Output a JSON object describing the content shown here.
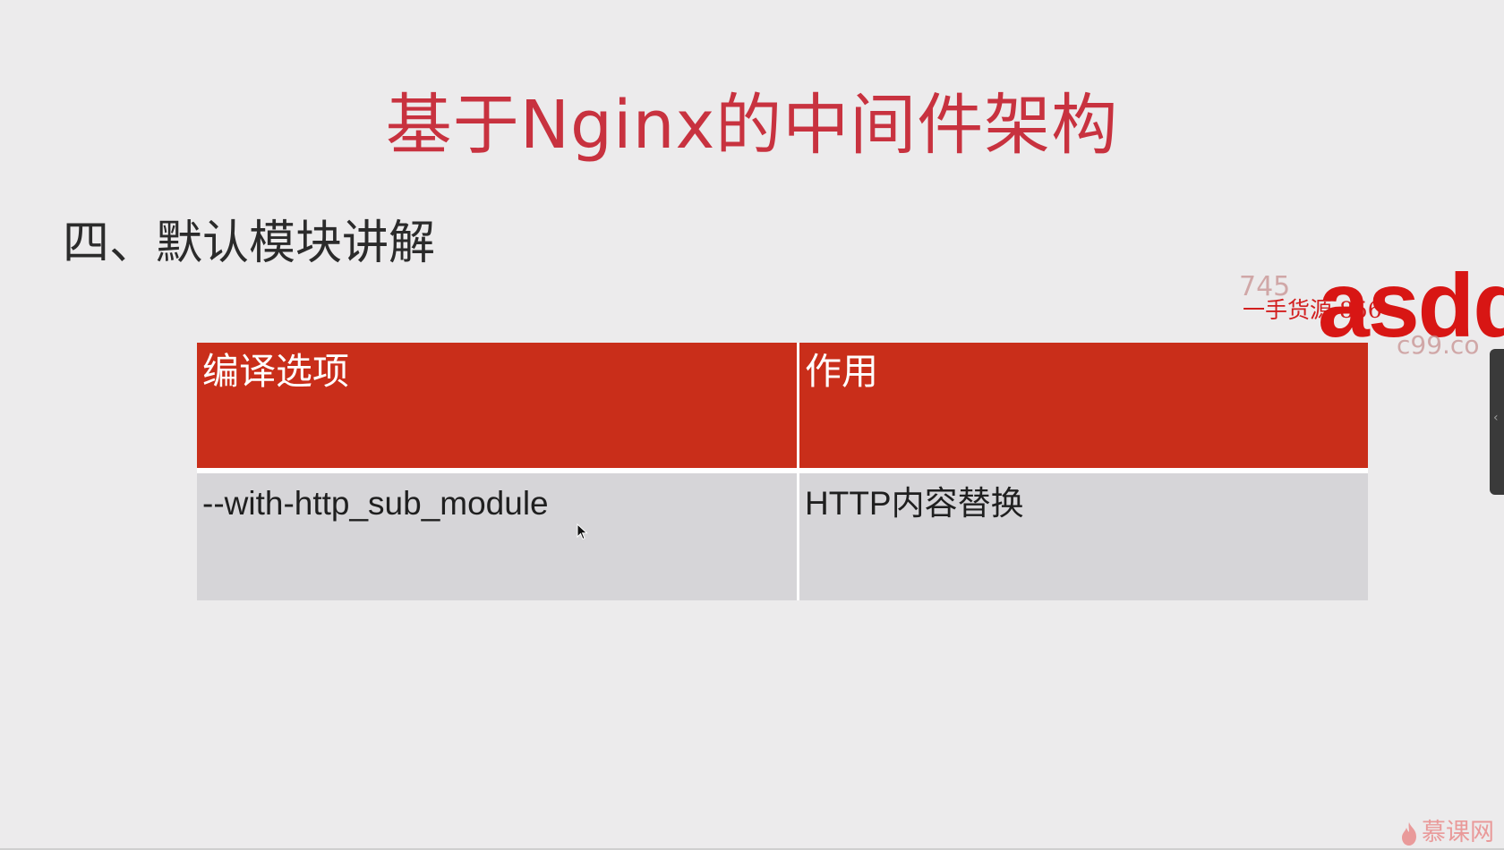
{
  "slide": {
    "title": "基于Nginx的中间件架构",
    "subtitle": "四、默认模块讲解"
  },
  "table": {
    "headers": [
      "编译选项",
      "作用"
    ],
    "rows": [
      [
        "--with-http_sub_module",
        "HTTP内容替换"
      ]
    ]
  },
  "watermark": {
    "faint_top": "745",
    "text": "一手货源  856",
    "big": "asdd",
    "faint_bottom": "c99.co"
  },
  "brand": {
    "text": "慕课网"
  },
  "colors": {
    "title": "#c8323f",
    "header_bg": "#c92e1a",
    "row_bg": "#d6d5d8",
    "background": "#ecebec"
  },
  "icons": [
    "mouse-cursor-icon",
    "chevron-left-icon",
    "brand-flame-icon"
  ]
}
